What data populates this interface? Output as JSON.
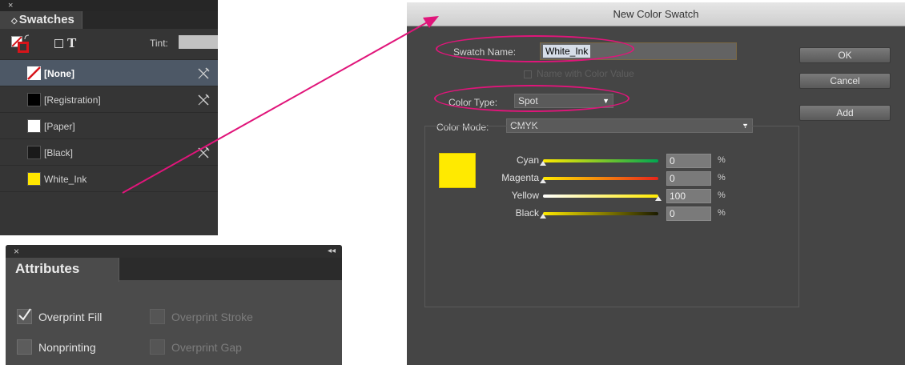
{
  "swatches_panel": {
    "close": "×",
    "tab_label": "Swatches",
    "tab_chevron": "◇",
    "tint_label": "Tint:",
    "t_label": "T",
    "items": [
      {
        "name": "[None]",
        "chip": "none",
        "selected": true,
        "locked": true
      },
      {
        "name": "[Registration]",
        "chip": "#000000",
        "selected": false,
        "locked": true
      },
      {
        "name": "[Paper]",
        "chip": "#ffffff",
        "selected": false,
        "locked": false
      },
      {
        "name": "[Black]",
        "chip": "#1a1a1a",
        "selected": false,
        "locked": true
      },
      {
        "name": "White_Ink",
        "chip": "#ffe600",
        "selected": false,
        "locked": false
      }
    ]
  },
  "attributes_panel": {
    "close": "×",
    "collapse": "◂◂",
    "tab_label": "Attributes",
    "options": [
      {
        "label": "Overprint Fill",
        "checked": true,
        "enabled": true
      },
      {
        "label": "Overprint Stroke",
        "checked": false,
        "enabled": false
      },
      {
        "label": "Nonprinting",
        "checked": false,
        "enabled": true
      },
      {
        "label": "Overprint Gap",
        "checked": false,
        "enabled": false
      }
    ]
  },
  "dialog": {
    "title": "New Color Swatch",
    "swatch_name_label": "Swatch Name:",
    "swatch_name_value": "White_Ink",
    "name_with_value_label": "Name with Color Value",
    "color_type_label": "Color Type:",
    "color_type_value": "Spot",
    "color_mode_label": "Color Mode:",
    "color_mode_value": "CMYK",
    "buttons": {
      "ok": "OK",
      "cancel": "Cancel",
      "add": "Add"
    },
    "preview_color": "#ffea00",
    "channels": [
      {
        "label": "Cyan",
        "value": "0",
        "unit": "%"
      },
      {
        "label": "Magenta",
        "value": "0",
        "unit": "%"
      },
      {
        "label": "Yellow",
        "value": "100",
        "unit": "%"
      },
      {
        "label": "Black",
        "value": "0",
        "unit": "%"
      }
    ]
  },
  "callout_color": "#e0157a"
}
